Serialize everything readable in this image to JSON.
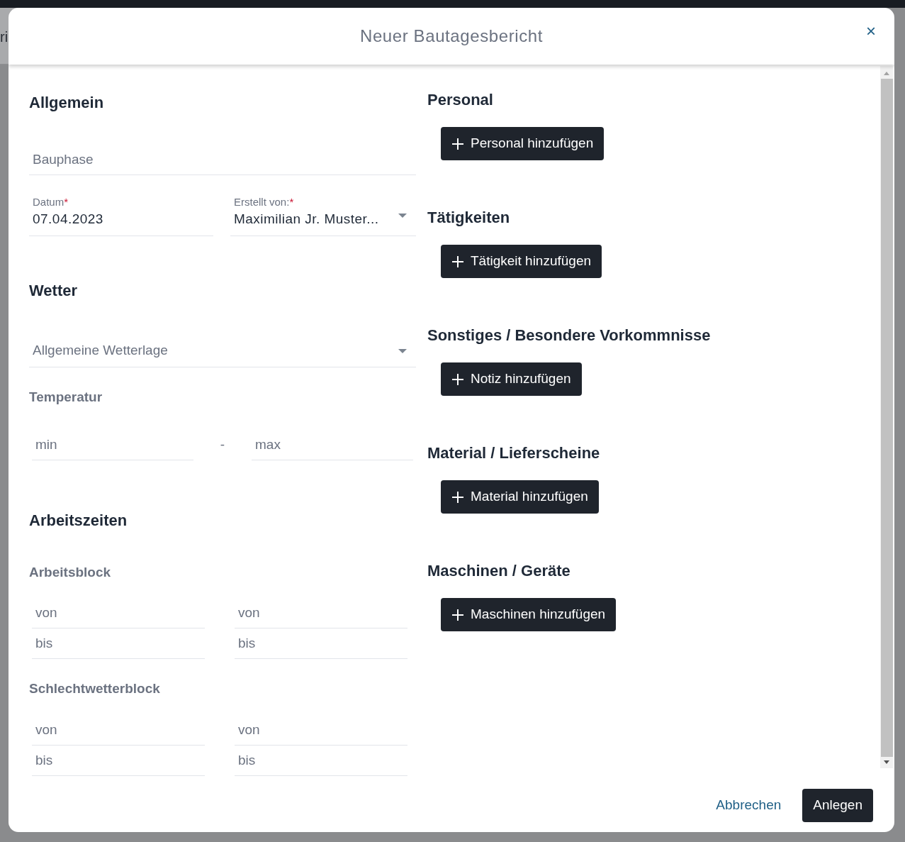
{
  "background": {
    "text": "ri"
  },
  "dialog": {
    "title": "Neuer Bautagesbericht",
    "close": "×"
  },
  "general": {
    "heading": "Allgemein",
    "phase_field": {
      "placeholder": "Bauphase"
    },
    "date_field": {
      "label": "Datum",
      "required_mark": "*",
      "value": "07.04.2023"
    },
    "author_field": {
      "label": "Erstellt von:",
      "required_mark": "*",
      "value": "Maximilian Jr. Muster..."
    }
  },
  "weather": {
    "heading": "Wetter",
    "condition_field": {
      "placeholder": "Allgemeine Wetterlage"
    },
    "temperature": {
      "heading": "Temperatur",
      "min_placeholder": "min",
      "separator": "-",
      "max_placeholder": "max"
    }
  },
  "working_hours": {
    "heading": "Arbeitszeiten",
    "blocks": [
      {
        "heading": "Arbeitsblock",
        "columns": [
          {
            "from_placeholder": "von",
            "to_placeholder": "bis"
          },
          {
            "from_placeholder": "von",
            "to_placeholder": "bis"
          }
        ]
      },
      {
        "heading": "Schlechtwetterblock",
        "columns": [
          {
            "from_placeholder": "von",
            "to_placeholder": "bis"
          },
          {
            "from_placeholder": "von",
            "to_placeholder": "bis"
          }
        ]
      }
    ]
  },
  "sections": [
    {
      "heading": "Personal",
      "button": "Personal hinzufügen"
    },
    {
      "heading": "Tätigkeiten",
      "button": "Tätigkeit hinzufügen"
    },
    {
      "heading": "Sonstiges / Besondere Vorkommnisse",
      "button": "Notiz hinzufügen"
    },
    {
      "heading": "Material / Lieferscheine",
      "button": "Material hinzufügen"
    },
    {
      "heading": "Maschinen / Geräte",
      "button": "Maschinen hinzufügen"
    }
  ],
  "footer": {
    "cancel": "Abbrechen",
    "submit": "Anlegen"
  }
}
